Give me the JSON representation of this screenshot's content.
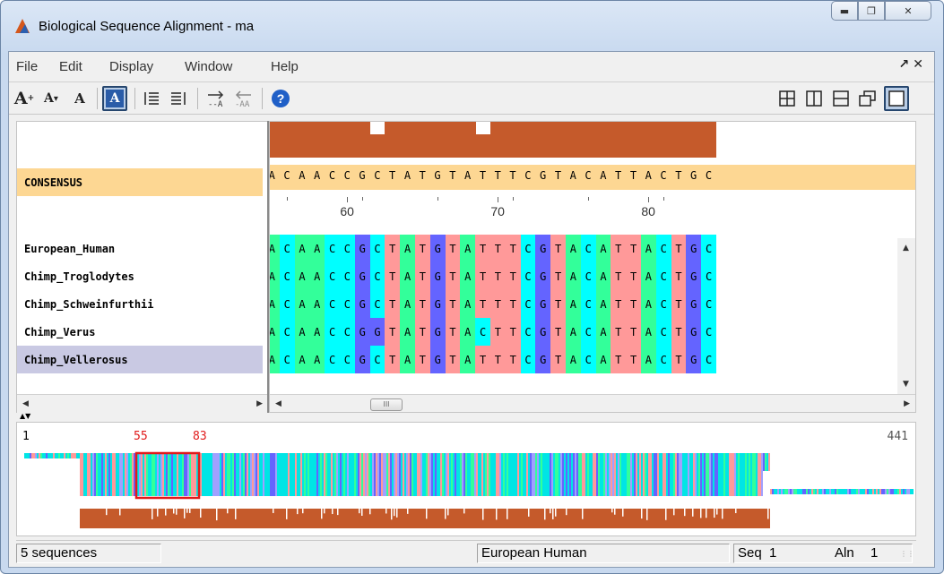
{
  "window": {
    "title": "Biological Sequence Alignment - ma",
    "controls": [
      "minimize",
      "maximize",
      "close"
    ]
  },
  "menu": [
    "File",
    "Edit",
    "Display",
    "Window",
    "Help"
  ],
  "toolbar": {
    "font_increase": "A",
    "font_decrease": "A",
    "font_reset": "A",
    "font_bold": "A",
    "help": "?"
  },
  "consensus": {
    "label": "CONSENSUS",
    "sequence": "ACAACCGCTATGTATTTCGTACATTACTGC"
  },
  "ruler": {
    "ticks": [
      60,
      70,
      80
    ]
  },
  "sequences": [
    {
      "name": "European_Human",
      "seq": "ACAACCGCTATGTATTTCGTACATTACTGC"
    },
    {
      "name": "Chimp_Troglodytes",
      "seq": "ACAACCGCTATGTATTTCGTACATTACTGC"
    },
    {
      "name": "Chimp_Schweinfurthii",
      "seq": "ACAACCGCTATGTATTTCGTACATTACTGC"
    },
    {
      "name": "Chimp_Verus",
      "seq": "ACAACCGGTATGTACTTCGTACATTACTGC"
    },
    {
      "name": "Chimp_Vellerosus",
      "seq": "ACAACCGCTATGTATTTCGTACATTACTGC",
      "selected": true
    }
  ],
  "base_colors": {
    "A": "#33ff9a",
    "C": "#00ffff",
    "G": "#6464ff",
    "T": "#ff9999"
  },
  "overview": {
    "start": "1",
    "end": "441",
    "window_start": "55",
    "window_end": "83"
  },
  "status": {
    "sequences": "5 sequences",
    "current": "European Human",
    "seq_label": "Seq",
    "seq_value": "1",
    "aln_label": "Aln",
    "aln_value": "1"
  },
  "thumb_grip": "III"
}
